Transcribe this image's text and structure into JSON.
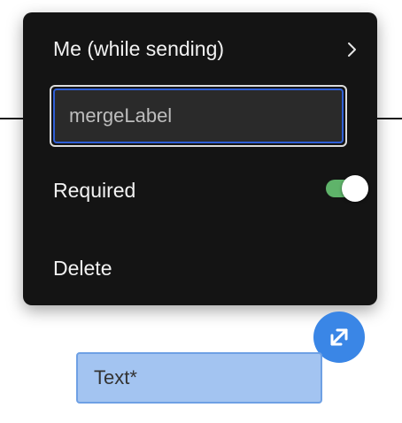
{
  "popover": {
    "signer_label": "Me (while sending)",
    "merge_label_value": "mergeLabel",
    "required_label": "Required",
    "required_on": true,
    "delete_label": "Delete"
  },
  "field": {
    "label": "Text*"
  },
  "colors": {
    "popover_bg": "#141414",
    "toggle_on": "#5fb36a",
    "input_focus": "#2f5fd6",
    "resize_button": "#3a86e6",
    "field_fill": "#a3c4f1"
  },
  "icons": {
    "signer_chevron": "chevron-right-icon",
    "resize": "expand-diagonal-icon"
  }
}
